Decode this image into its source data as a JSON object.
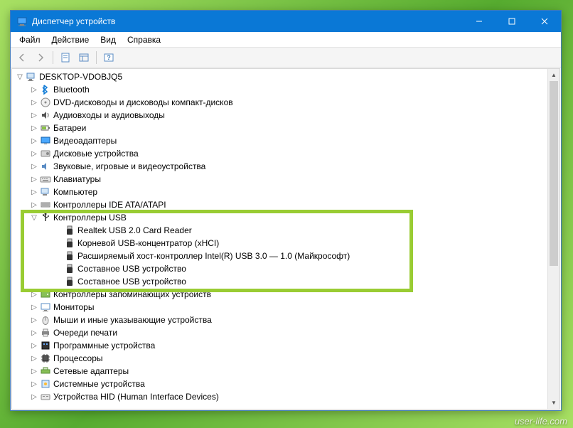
{
  "window": {
    "title": "Диспетчер устройств"
  },
  "menu": {
    "file": "Файл",
    "action": "Действие",
    "view": "Вид",
    "help": "Справка"
  },
  "tree": {
    "root": "DESKTOP-VDOBJQ5",
    "categories": [
      {
        "label": "Bluetooth",
        "icon": "bluetooth",
        "exp": "▷"
      },
      {
        "label": "DVD-дисководы и дисководы компакт-дисков",
        "icon": "disc",
        "exp": "▷"
      },
      {
        "label": "Аудиовходы и аудиовыходы",
        "icon": "audio",
        "exp": "▷"
      },
      {
        "label": "Батареи",
        "icon": "battery",
        "exp": "▷"
      },
      {
        "label": "Видеоадаптеры",
        "icon": "display",
        "exp": "▷"
      },
      {
        "label": "Дисковые устройства",
        "icon": "drive",
        "exp": "▷"
      },
      {
        "label": "Звуковые, игровые и видеоустройства",
        "icon": "sound",
        "exp": "▷"
      },
      {
        "label": "Клавиатуры",
        "icon": "keyboard",
        "exp": "▷"
      },
      {
        "label": "Компьютер",
        "icon": "computer",
        "exp": "▷"
      },
      {
        "label": "Контроллеры IDE ATA/ATAPI",
        "icon": "ide",
        "exp": "▷",
        "cut": true
      },
      {
        "label": "Контроллеры USB",
        "icon": "usb",
        "exp": "▽",
        "children": [
          "Realtek USB 2.0 Card Reader",
          "Корневой USB-концентратор (xHCI)",
          "Расширяемый хост-контроллер Intel(R) USB 3.0 — 1.0 (Майкрософт)",
          "Составное USB устройство",
          "Составное USB устройство"
        ]
      },
      {
        "label": "Контроллеры запоминающих устройств",
        "icon": "storage",
        "exp": "▷"
      },
      {
        "label": "Мониторы",
        "icon": "monitor",
        "exp": "▷"
      },
      {
        "label": "Мыши и иные указывающие устройства",
        "icon": "mouse",
        "exp": "▷"
      },
      {
        "label": "Очереди печати",
        "icon": "printer",
        "exp": "▷"
      },
      {
        "label": "Программные устройства",
        "icon": "soft",
        "exp": "▷"
      },
      {
        "label": "Процессоры",
        "icon": "cpu",
        "exp": "▷"
      },
      {
        "label": "Сетевые адаптеры",
        "icon": "network",
        "exp": "▷"
      },
      {
        "label": "Системные устройства",
        "icon": "system",
        "exp": "▷"
      },
      {
        "label": "Устройства HID (Human Interface Devices)",
        "icon": "hid",
        "exp": "▷",
        "cut": true
      }
    ]
  },
  "watermark": "user-life.com"
}
